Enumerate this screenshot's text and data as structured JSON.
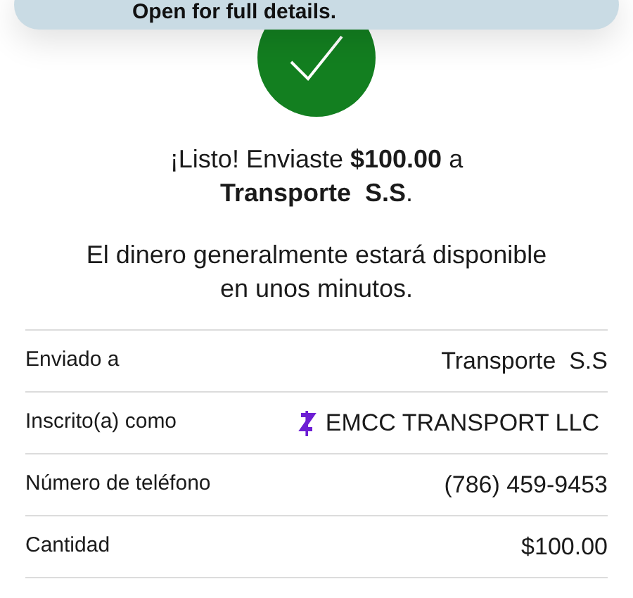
{
  "notification": {
    "text": "Open for full details."
  },
  "confirmation": {
    "message": "¡Listo! Enviaste **$100.00** a **Transporte  S.S**.",
    "note": "El dinero generalmente estará disponible en unos minutos."
  },
  "details": [
    {
      "kind": "plain",
      "label": "Enviado a",
      "value": "Transporte  S.S"
    },
    {
      "kind": "enrolled",
      "label": "Inscrito(a) como",
      "value": "EMCC TRANSPORT LLC"
    },
    {
      "kind": "plain",
      "label": "Número de teléfono",
      "value": "(786) 459-9453"
    },
    {
      "kind": "plain",
      "label": "Cantidad",
      "value": "$100.00"
    }
  ]
}
